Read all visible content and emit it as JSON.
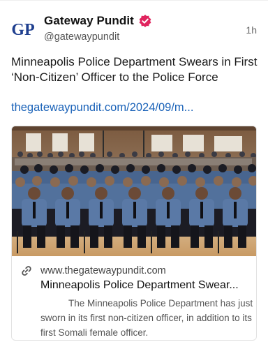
{
  "post": {
    "author_name": "Gateway Pundit",
    "author_handle": "@gatewaypundit",
    "avatar_text": "GP",
    "timestamp": "1h",
    "text": "Minneapolis Police Department Swears in First ‘Non-Citizen’ Officer to the Police Force",
    "link_text": "thegatewaypundit.com/2024/09/m...",
    "verified_icon": "verified-badge-icon"
  },
  "link_card": {
    "domain": "www.thegatewaypundit.com",
    "title": "Minneapolis Police Department Swear...",
    "description": "The Minneapolis Police Department has just sworn in its first non-citizen officer, in addition to its first Somali female officer.",
    "image_alt": "Photo of police officers in uniform seated in rows at a ceremony",
    "link_icon": "link-chain-icon"
  },
  "colors": {
    "verified_badge": "#e0245e",
    "link": "#1a62b8",
    "avatar_blue": "#1f3f8f",
    "uniform": "#4d6c97"
  }
}
